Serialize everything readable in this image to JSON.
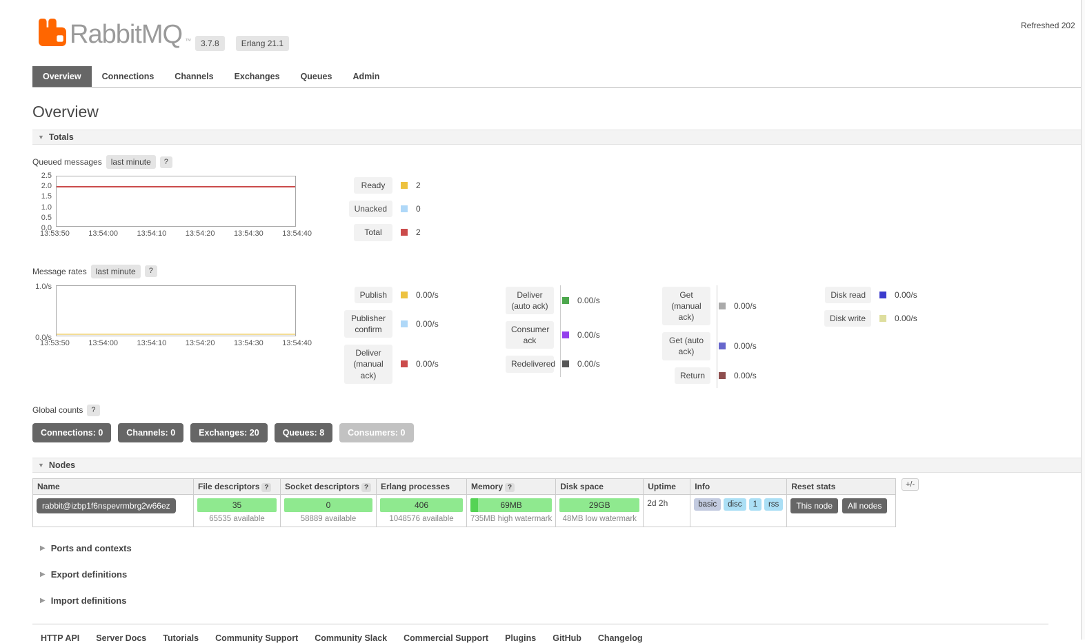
{
  "colors": {
    "accent_orange": "#ff6600",
    "tab_active_bg": "#666666",
    "badge_dark": "#666666",
    "badge_muted": "#c2c2c2",
    "bar_green": "#8fe98f",
    "bar_green_dark": "#54d354",
    "info_basic": "#c3cbe0",
    "info_blue": "#abdff5"
  },
  "icons": {
    "section_expanded": "▼",
    "section_collapsed": "▶"
  },
  "header": {
    "brand": "RabbitMQ",
    "tm": "™",
    "version": "3.7.8",
    "erlang": "Erlang 21.1",
    "refreshed": "Refreshed 202"
  },
  "nav": {
    "tabs": [
      "Overview",
      "Connections",
      "Channels",
      "Exchanges",
      "Queues",
      "Admin"
    ]
  },
  "page_title": "Overview",
  "totals_section": {
    "label": "Totals"
  },
  "queued": {
    "label": "Queued messages",
    "mode": "last minute",
    "help": "?"
  },
  "rates": {
    "label": "Message rates",
    "mode": "last minute",
    "help": "?"
  },
  "chart_data": [
    {
      "type": "line",
      "title": "Queued messages",
      "x": [
        "13:53:50",
        "13:54:00",
        "13:54:10",
        "13:54:20",
        "13:54:30",
        "13:54:40"
      ],
      "y_ticks": [
        "2.5",
        "2.0",
        "1.5",
        "1.0",
        "0.5",
        "0.0"
      ],
      "ylim": [
        0,
        2.5
      ],
      "grid": false,
      "legend_position": "right",
      "series": [
        {
          "name": "Ready",
          "color": "#edc240",
          "display": "2",
          "values": [
            2,
            2,
            2,
            2,
            2,
            2
          ]
        },
        {
          "name": "Unacked",
          "color": "#afd8f8",
          "display": "0",
          "values": [
            0,
            0,
            0,
            0,
            0,
            0
          ]
        },
        {
          "name": "Total",
          "color": "#cb4b4b",
          "display": "2",
          "values": [
            2,
            2,
            2,
            2,
            2,
            2
          ]
        }
      ]
    },
    {
      "type": "line",
      "title": "Message rates",
      "x": [
        "13:53:50",
        "13:54:00",
        "13:54:10",
        "13:54:20",
        "13:54:30",
        "13:54:40"
      ],
      "y_ticks": [
        "1.0/s",
        "0.0/s"
      ],
      "ylim": [
        0,
        1.0
      ],
      "grid": false,
      "legend_position": "right",
      "series": [
        {
          "name": "Publish",
          "color": "#edc240",
          "display": "0.00/s",
          "values": [
            0,
            0,
            0,
            0,
            0,
            0
          ]
        },
        {
          "name": "Publisher confirm",
          "color": "#afd8f8",
          "display": "0.00/s",
          "values": [
            0,
            0,
            0,
            0,
            0,
            0
          ]
        },
        {
          "name": "Deliver (manual ack)",
          "color": "#cb4b4b",
          "display": "0.00/s",
          "values": [
            0,
            0,
            0,
            0,
            0,
            0
          ]
        },
        {
          "name": "Deliver (auto ack)",
          "color": "#4da74d",
          "display": "0.00/s",
          "values": [
            0,
            0,
            0,
            0,
            0,
            0
          ]
        },
        {
          "name": "Consumer ack",
          "color": "#9440ed",
          "display": "0.00/s",
          "values": [
            0,
            0,
            0,
            0,
            0,
            0
          ]
        },
        {
          "name": "Redelivered",
          "color": "#575757",
          "display": "0.00/s",
          "values": [
            0,
            0,
            0,
            0,
            0,
            0
          ]
        },
        {
          "name": "Get (manual ack)",
          "color": "#aaaaaa",
          "display": "0.00/s",
          "values": [
            0,
            0,
            0,
            0,
            0,
            0
          ]
        },
        {
          "name": "Get (auto ack)",
          "color": "#6666cc",
          "display": "0.00/s",
          "values": [
            0,
            0,
            0,
            0,
            0,
            0
          ]
        },
        {
          "name": "Return",
          "color": "#8e4e4e",
          "display": "0.00/s",
          "values": [
            0,
            0,
            0,
            0,
            0,
            0
          ]
        },
        {
          "name": "Disk read",
          "color": "#3b3bcd",
          "display": "0.00/s",
          "values": [
            0,
            0,
            0,
            0,
            0,
            0
          ]
        },
        {
          "name": "Disk write",
          "color": "#dede9e",
          "display": "0.00/s",
          "values": [
            0,
            0,
            0,
            0,
            0,
            0
          ]
        }
      ]
    }
  ],
  "global_counts": {
    "label": "Global counts",
    "help": "?",
    "items": [
      {
        "text": "Connections: 0"
      },
      {
        "text": "Channels: 0"
      },
      {
        "text": "Exchanges: 20"
      },
      {
        "text": "Queues: 8"
      },
      {
        "text": "Consumers: 0"
      }
    ]
  },
  "nodes_section": {
    "label": "Nodes",
    "plus_minus": "+/-"
  },
  "nodes_table": {
    "headers": {
      "name": "Name",
      "fd": "File descriptors",
      "sd": "Socket descriptors",
      "erlang": "Erlang processes",
      "memory": "Memory",
      "disk": "Disk space",
      "uptime": "Uptime",
      "info": "Info",
      "reset": "Reset stats",
      "help": "?"
    },
    "row": {
      "name": "rabbit@izbp1f6nspevrmbrg2w66ez",
      "fd_used": "35",
      "fd_available": "65535 available",
      "sd_used": "0",
      "sd_available": "58889 available",
      "proc_used": "406",
      "proc_available": "1048576 available",
      "mem_used": "69MB",
      "mem_note": "735MB high watermark",
      "disk_used": "29GB",
      "disk_note": "48MB low watermark",
      "uptime": "2d 2h",
      "info_badges": [
        "basic",
        "disc",
        "1",
        "rss"
      ],
      "reset_this": "This node",
      "reset_all": "All nodes"
    }
  },
  "collapsed_sections": [
    "Ports and contexts",
    "Export definitions",
    "Import definitions"
  ],
  "footer": {
    "links": [
      "HTTP API",
      "Server Docs",
      "Tutorials",
      "Community Support",
      "Community Slack",
      "Commercial Support",
      "Plugins",
      "GitHub",
      "Changelog"
    ]
  }
}
